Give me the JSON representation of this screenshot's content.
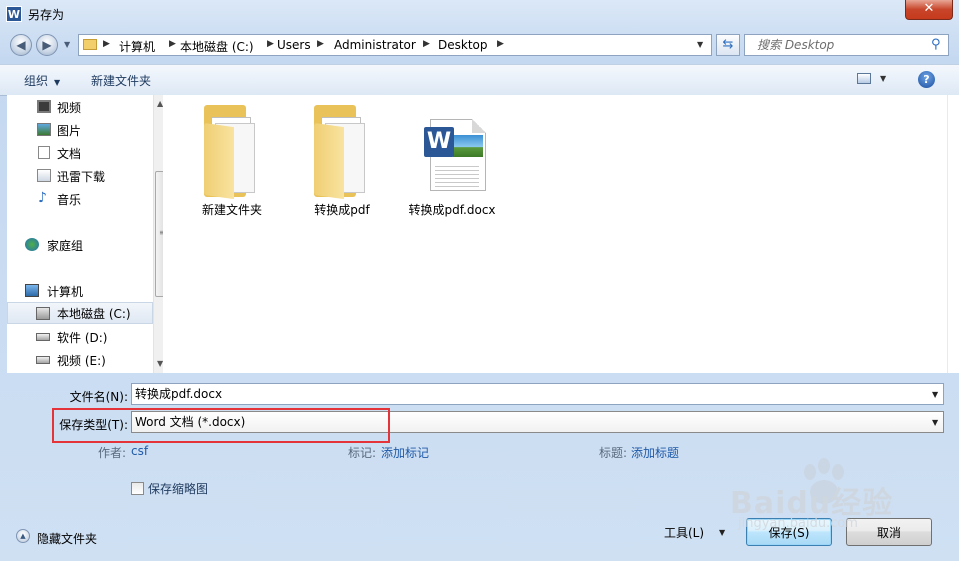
{
  "window": {
    "title": "另存为",
    "app_icon": "W",
    "close_label": "✕"
  },
  "address_bar": {
    "crumbs": [
      "计算机",
      "本地磁盘 (C:)",
      "Users",
      "Administrator",
      "Desktop"
    ]
  },
  "search": {
    "placeholder": "搜索 Desktop"
  },
  "toolbar": {
    "organize_label": "组织",
    "new_folder_label": "新建文件夹",
    "help_label": "?"
  },
  "sidebar": {
    "items": [
      {
        "label": "视频",
        "icon": "video-library-icon"
      },
      {
        "label": "图片",
        "icon": "picture-library-icon"
      },
      {
        "label": "文档",
        "icon": "document-library-icon"
      },
      {
        "label": "迅雷下载",
        "icon": "download-library-icon"
      },
      {
        "label": "音乐",
        "icon": "music-library-icon"
      },
      {
        "label": "家庭组",
        "icon": "homegroup-icon"
      },
      {
        "label": "计算机",
        "icon": "computer-icon"
      },
      {
        "label": "本地磁盘 (C:)",
        "icon": "system-drive-icon",
        "selected": true
      },
      {
        "label": "软件 (D:)",
        "icon": "drive-icon"
      },
      {
        "label": "视频 (E:)",
        "icon": "drive-icon"
      }
    ]
  },
  "files": [
    {
      "name": "新建文件夹",
      "type": "folder"
    },
    {
      "name": "转换成pdf",
      "type": "folder"
    },
    {
      "name": "转换成pdf.docx",
      "type": "word-document"
    }
  ],
  "form": {
    "filename_label": "文件名(N):",
    "filename_value": "转换成pdf.docx",
    "savetype_label": "保存类型(T):",
    "savetype_value": "Word 文档 (*.docx)",
    "author_label": "作者:",
    "author_value": "csf",
    "tags_label": "标记:",
    "tags_value": "添加标记",
    "title_label": "标题:",
    "title_value": "添加标题",
    "thumbnail_label": "保存缩略图"
  },
  "footer": {
    "hide_folders_label": "隐藏文件夹",
    "tools_label": "工具(L)",
    "save_label": "保存(S)",
    "cancel_label": "取消"
  },
  "watermark": {
    "text": "Baidu经验",
    "subtext": "jingyan.baidu.com"
  },
  "colors": {
    "highlight_box": "#e5333a",
    "link": "#1f5aa8",
    "word_blue": "#2b5797"
  }
}
